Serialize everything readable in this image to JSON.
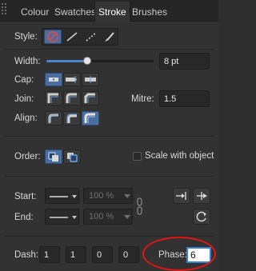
{
  "tabs": [
    {
      "label": "Colour",
      "active": false
    },
    {
      "label": "Swatches",
      "active": false
    },
    {
      "label": "Stroke",
      "active": true
    },
    {
      "label": "Brushes",
      "active": false
    }
  ],
  "style": {
    "label": "Style:",
    "options": [
      "none-style-icon",
      "solid-line-icon",
      "dashed-line-icon",
      "brush-icon"
    ]
  },
  "width": {
    "label": "Width:",
    "value": "8 pt",
    "slider_fraction": 0.39
  },
  "cap": {
    "label": "Cap:",
    "options": [
      "butt-cap-icon",
      "round-cap-icon",
      "square-cap-icon"
    ]
  },
  "join": {
    "label": "Join:",
    "options": [
      "mitre-join-icon",
      "round-join-icon",
      "bevel-join-icon"
    ]
  },
  "mitre": {
    "label": "Mitre:",
    "value": "1.5"
  },
  "align": {
    "label": "Align:",
    "options": [
      "align-center-icon",
      "align-inside-icon",
      "align-outside-icon"
    ]
  },
  "order": {
    "label": "Order:",
    "options": [
      "fill-over-stroke-icon",
      "stroke-over-fill-icon"
    ]
  },
  "scale": {
    "label": "Scale with object",
    "checked": false
  },
  "arrowheads": {
    "start": {
      "label": "Start:",
      "scale": "100 %"
    },
    "end": {
      "label": "End:",
      "scale": "100 %"
    }
  },
  "dash": {
    "label": "Dash:",
    "values": [
      "1",
      "1",
      "0",
      "0"
    ]
  },
  "phase": {
    "label": "Phase:",
    "value": "6"
  },
  "colors": {
    "accent": "#4b6ea0",
    "annotation": "#e01616"
  }
}
